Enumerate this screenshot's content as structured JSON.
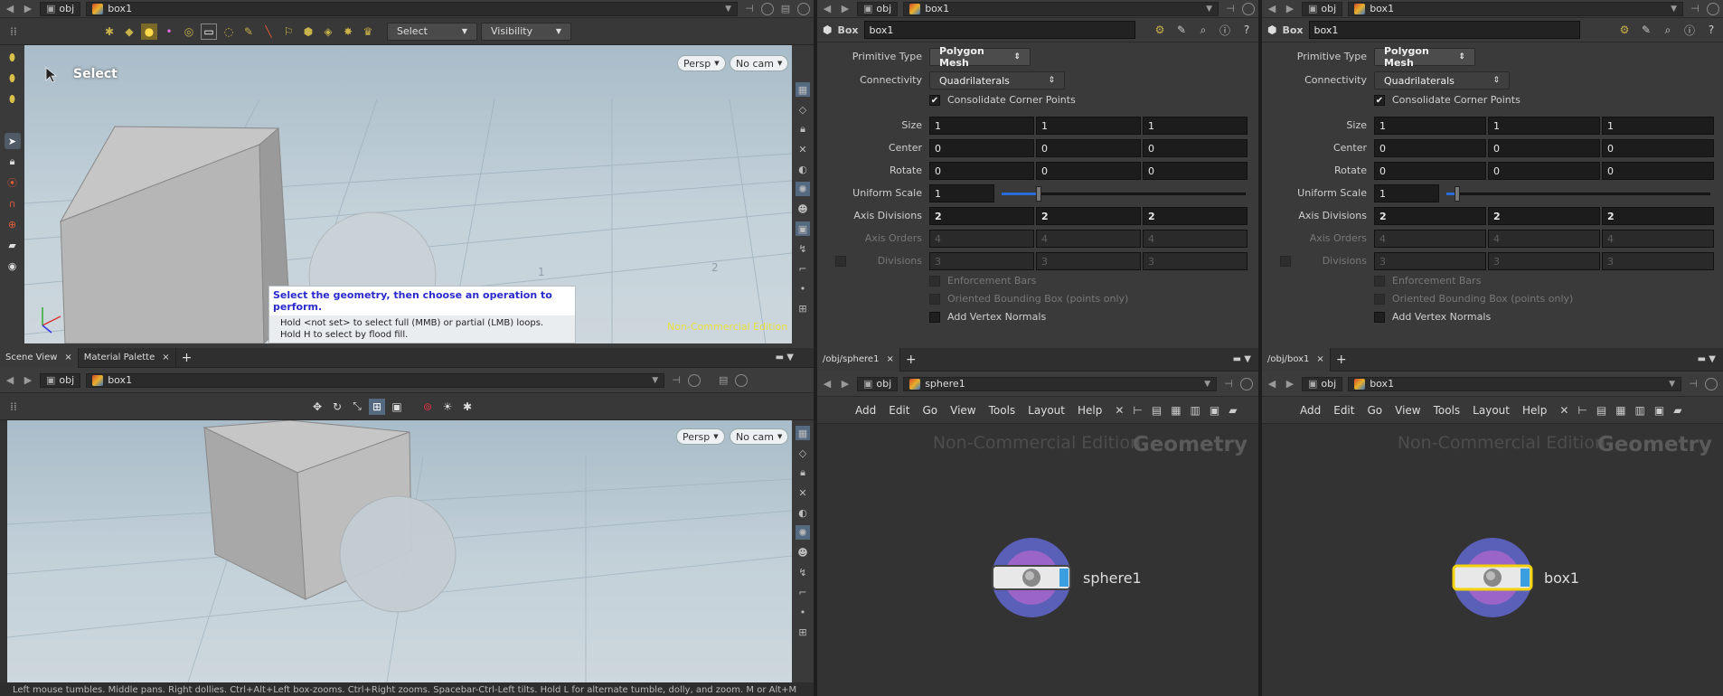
{
  "colors": {
    "accent": "#3a9ee0",
    "selection": "#f2d20a",
    "watermark_yellow": "#e8e040",
    "handle_blue": "#2a6bd8"
  },
  "left_top": {
    "path": {
      "root": "obj",
      "node": "box1"
    },
    "toolbar": {
      "select_label": "Select",
      "visibility_label": "Visibility"
    },
    "viewport": {
      "tool_label": "Select",
      "persp": "Persp",
      "cam": "No cam",
      "hint_title": "Select the geometry, then choose an operation to perform.",
      "hint_line1": "Hold <not set> to select full (MMB) or partial (LMB) loops.",
      "hint_line2": "Hold H to select by flood fill.",
      "watermark": "Non-Commercial Edition",
      "grid_labels": [
        "1",
        "2"
      ]
    }
  },
  "left_tabs": [
    "Scene View",
    "Material Palette"
  ],
  "left_bottom": {
    "path": {
      "root": "obj",
      "node": "box1"
    },
    "viewport": {
      "persp": "Persp",
      "cam": "No cam"
    },
    "status": "Left mouse tumbles. Middle pans. Right dollies. Ctrl+Alt+Left box-zooms. Ctrl+Right zooms. Spacebar-Ctrl-Left tilts. Hold L for alternate tumble, dolly, and zoom. M or Alt+M"
  },
  "param_panels": [
    {
      "path": {
        "root": "obj",
        "node": "box1"
      },
      "type": "Box",
      "name": "box1",
      "primitive_type_label": "Primitive Type",
      "primitive_type": "Polygon Mesh",
      "connectivity_label": "Connectivity",
      "connectivity": "Quadrilaterals",
      "consolidate_label": "Consolidate Corner Points",
      "size_label": "Size",
      "size": [
        "1",
        "1",
        "1"
      ],
      "center_label": "Center",
      "center": [
        "0",
        "0",
        "0"
      ],
      "rotate_label": "Rotate",
      "rotate": [
        "0",
        "0",
        "0"
      ],
      "uniform_label": "Uniform Scale",
      "uniform": "1",
      "uniform_slider": 0.15,
      "axisdiv_label": "Axis Divisions",
      "axisdiv": [
        "2",
        "2",
        "2"
      ],
      "axisord_label": "Axis Orders",
      "axisord": [
        "4",
        "4",
        "4"
      ],
      "div_label": "Divisions",
      "div": [
        "3",
        "3",
        "3"
      ],
      "enforce_label": "Enforcement Bars",
      "obb_label": "Oriented Bounding Box (points only)",
      "vnormals_label": "Add Vertex Normals"
    },
    {
      "path": {
        "root": "obj",
        "node": "box1"
      },
      "type": "Box",
      "name": "box1",
      "primitive_type_label": "Primitive Type",
      "primitive_type": "Polygon Mesh",
      "connectivity_label": "Connectivity",
      "connectivity": "Quadrilaterals",
      "consolidate_label": "Consolidate Corner Points",
      "size_label": "Size",
      "size": [
        "1",
        "1",
        "1"
      ],
      "center_label": "Center",
      "center": [
        "0",
        "0",
        "0"
      ],
      "rotate_label": "Rotate",
      "rotate": [
        "0",
        "0",
        "0"
      ],
      "uniform_label": "Uniform Scale",
      "uniform": "1",
      "uniform_slider": 0.04,
      "axisdiv_label": "Axis Divisions",
      "axisdiv": [
        "2",
        "2",
        "2"
      ],
      "axisord_label": "Axis Orders",
      "axisord": [
        "4",
        "4",
        "4"
      ],
      "div_label": "Divisions",
      "div": [
        "3",
        "3",
        "3"
      ],
      "enforce_label": "Enforcement Bars",
      "obb_label": "Oriented Bounding Box (points only)",
      "vnormals_label": "Add Vertex Normals"
    }
  ],
  "net_panels": [
    {
      "tab": "/obj/sphere1",
      "path": {
        "root": "obj",
        "node": "sphere1"
      },
      "menu": [
        "Add",
        "Edit",
        "Go",
        "View",
        "Tools",
        "Layout",
        "Help"
      ],
      "watermark1": "Non-Commercial Edition",
      "watermark2": "Geometry",
      "node_name": "sphere1"
    },
    {
      "tab": "/obj/box1",
      "path": {
        "root": "obj",
        "node": "box1"
      },
      "menu": [
        "Add",
        "Edit",
        "Go",
        "View",
        "Tools",
        "Layout",
        "Help"
      ],
      "watermark1": "Non-Commercial Edition",
      "watermark2": "Geometry",
      "node_name": "box1"
    }
  ]
}
